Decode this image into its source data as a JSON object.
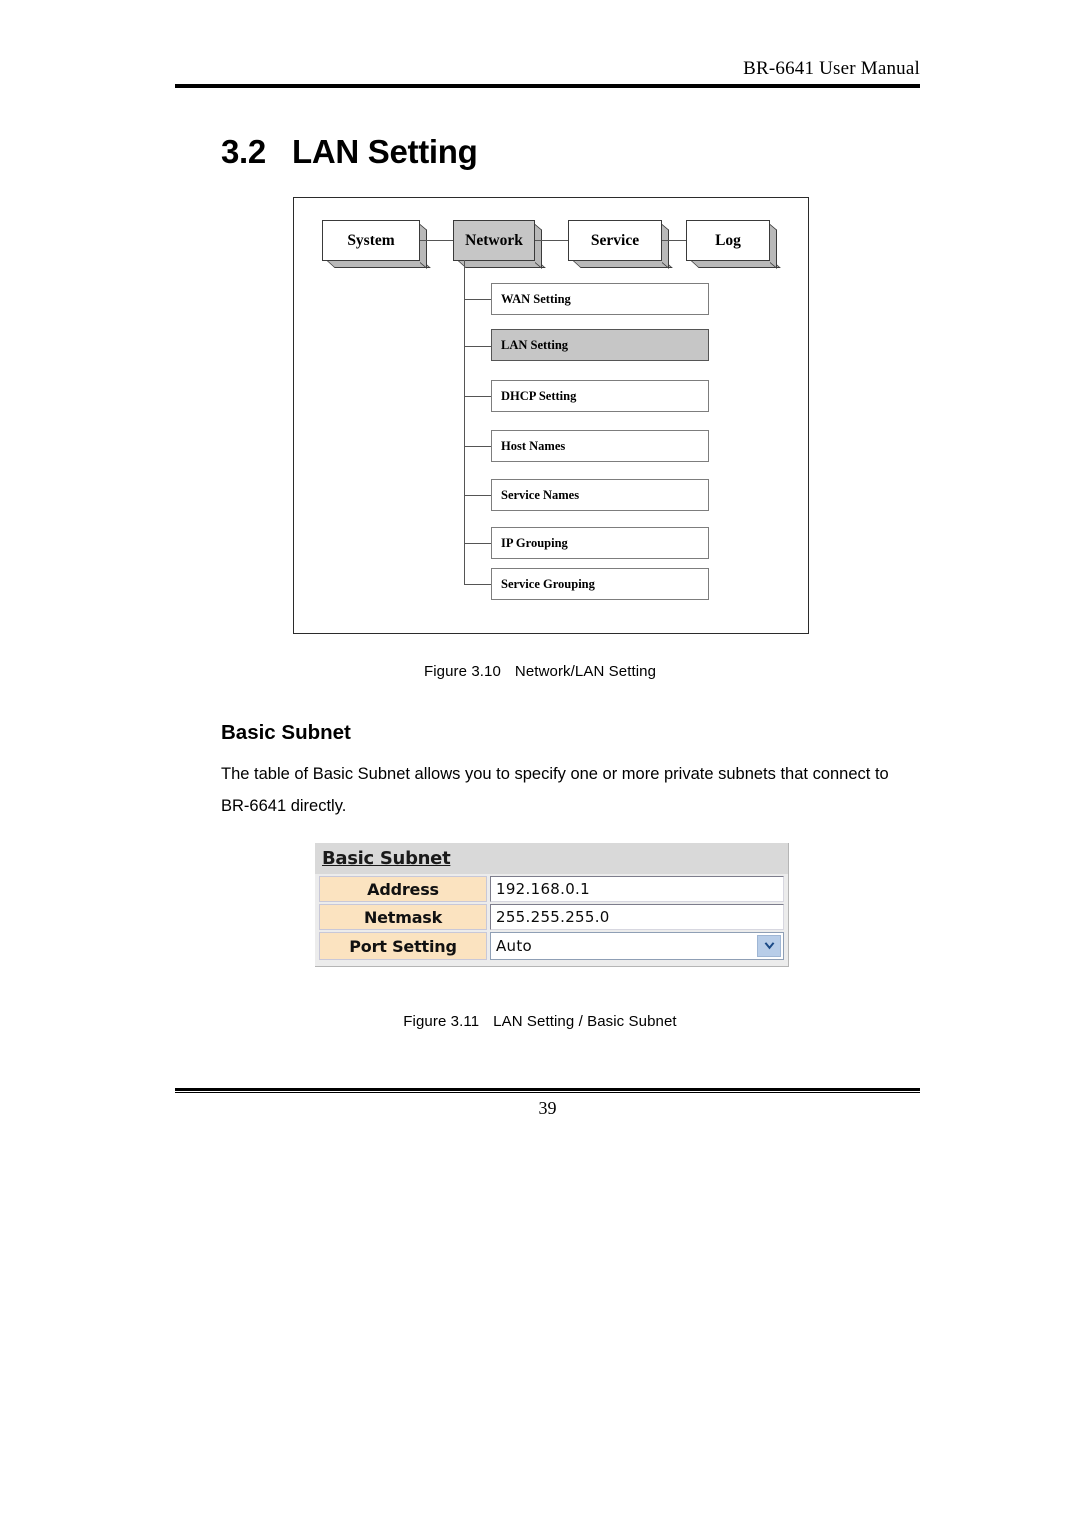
{
  "header": {
    "manual_title": "BR-6641 User Manual"
  },
  "section": {
    "number": "3.2",
    "title": "LAN Setting"
  },
  "diagram": {
    "top_menu": [
      {
        "label": "System",
        "selected": false
      },
      {
        "label": "Network",
        "selected": true
      },
      {
        "label": "Service",
        "selected": false
      },
      {
        "label": "Log",
        "selected": false
      }
    ],
    "submenu": [
      {
        "label": "WAN Setting",
        "selected": false
      },
      {
        "label": "LAN Setting",
        "selected": true
      },
      {
        "label": "DHCP Setting",
        "selected": false
      },
      {
        "label": "Host Names",
        "selected": false
      },
      {
        "label": "Service Names",
        "selected": false
      },
      {
        "label": "IP Grouping",
        "selected": false
      },
      {
        "label": "Service Grouping",
        "selected": false
      }
    ]
  },
  "figure_310": {
    "number": "Figure 3.10",
    "title": "Network/LAN Setting"
  },
  "subsection": {
    "heading": "Basic Subnet",
    "paragraph": "The table of Basic Subnet allows you to specify one or more private subnets that connect to BR-6641 directly."
  },
  "form": {
    "title": "Basic Subnet",
    "rows": [
      {
        "label": "Address",
        "value": "192.168.0.1",
        "type": "text"
      },
      {
        "label": "Netmask",
        "value": "255.255.255.0",
        "type": "text"
      },
      {
        "label": "Port Setting",
        "value": "Auto",
        "type": "select"
      }
    ],
    "dropdown_icon": "chevron-down-icon",
    "dropdown_glyph": "❯",
    "colors": {
      "label_cell": "#fbe3c0",
      "titlebar": "#d9d9d9",
      "panel": "#ececec",
      "arrow_button": "#b8cde8"
    }
  },
  "figure_311": {
    "number": "Figure 3.11",
    "title": "LAN Setting / Basic Subnet"
  },
  "footer": {
    "page_number": "39"
  }
}
